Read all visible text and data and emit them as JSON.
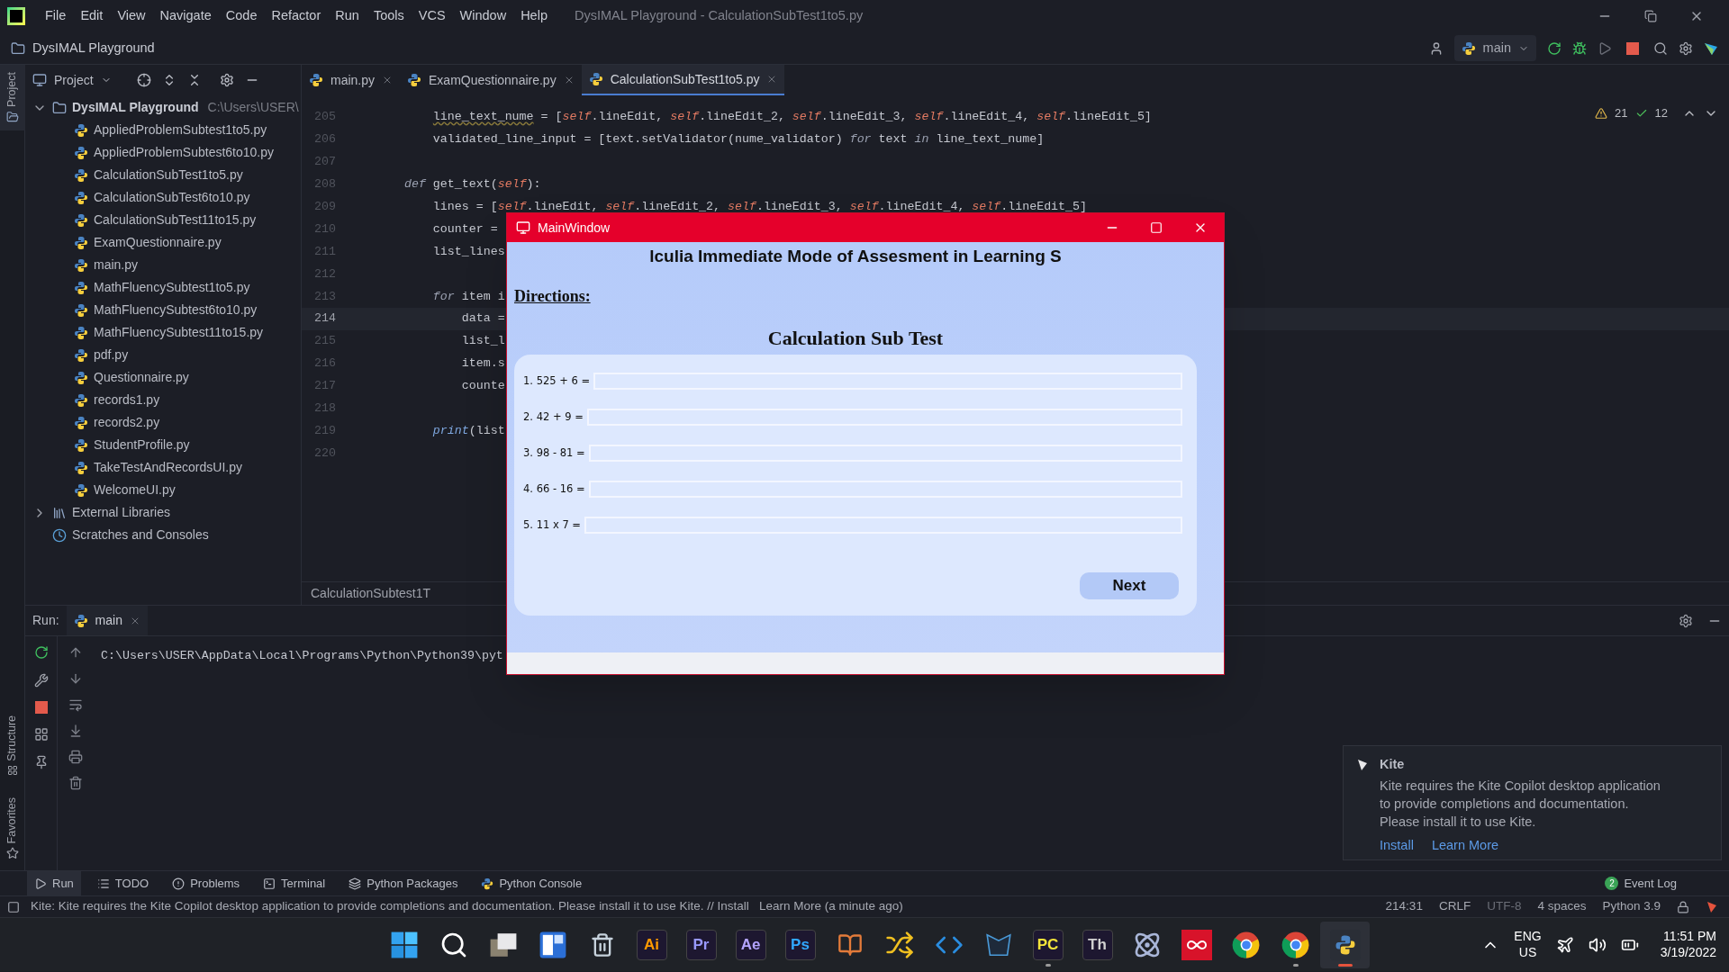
{
  "menu_bar": {
    "items": [
      "File",
      "Edit",
      "View",
      "Navigate",
      "Code",
      "Refactor",
      "Run",
      "Tools",
      "VCS",
      "Window",
      "Help"
    ],
    "title": "DysIMAL Playground - CalculationSubTest1to5.py"
  },
  "nav_bar": {
    "project": "DysIMAL Playground",
    "run_config": "main"
  },
  "project_panel": {
    "title": "Project",
    "tree": [
      {
        "label": "DysIMAL Playground",
        "path": "C:\\Users\\USER\\",
        "kind": "root",
        "expanded": true,
        "children": [
          {
            "label": "AppliedProblemSubtest1to5.py"
          },
          {
            "label": "AppliedProblemSubtest6to10.py"
          },
          {
            "label": "CalculationSubTest1to5.py"
          },
          {
            "label": "CalculationSubTest6to10.py"
          },
          {
            "label": "CalculationSubTest11to15.py"
          },
          {
            "label": "ExamQuestionnaire.py"
          },
          {
            "label": "main.py"
          },
          {
            "label": "MathFluencySubtest1to5.py"
          },
          {
            "label": "MathFluencySubtest6to10.py"
          },
          {
            "label": "MathFluencySubtest11to15.py"
          },
          {
            "label": "pdf.py"
          },
          {
            "label": "Questionnaire.py"
          },
          {
            "label": "records1.py"
          },
          {
            "label": "records2.py"
          },
          {
            "label": "StudentProfile.py"
          },
          {
            "label": "TakeTestAndRecordsUI.py"
          },
          {
            "label": "WelcomeUI.py"
          }
        ]
      },
      {
        "label": "External Libraries",
        "kind": "libraries",
        "expanded": false
      },
      {
        "label": "Scratches and Consoles",
        "kind": "scratches"
      }
    ]
  },
  "editor_tabs": [
    {
      "label": "main.py",
      "selected": false
    },
    {
      "label": "ExamQuestionnaire.py",
      "selected": false
    },
    {
      "label": "CalculationSubTest1to5.py",
      "selected": true
    }
  ],
  "inspections": {
    "warnings": "21",
    "passed": "12"
  },
  "code_lines": [
    {
      "number": "205",
      "current": false,
      "tokens": [
        {
          "kind": "typo",
          "text": "        line_text_nume"
        },
        {
          "kind": "plain",
          "text": " = ["
        },
        {
          "kind": "self",
          "text": "self"
        },
        {
          "kind": "plain",
          "text": ".lineEdit, "
        },
        {
          "kind": "self",
          "text": "self"
        },
        {
          "kind": "plain",
          "text": ".lineEdit_2, "
        },
        {
          "kind": "self",
          "text": "self"
        },
        {
          "kind": "plain",
          "text": ".lineEdit_3, "
        },
        {
          "kind": "self",
          "text": "self"
        },
        {
          "kind": "plain",
          "text": ".lineEdit_4, "
        },
        {
          "kind": "self",
          "text": "self"
        },
        {
          "kind": "plain",
          "text": ".lineEdit_5]"
        }
      ]
    },
    {
      "number": "206",
      "current": false,
      "tokens": [
        {
          "kind": "plain",
          "text": "        validated_line_input = [text.setValidator(nume_validator) "
        },
        {
          "kind": "keyword",
          "text": "for"
        },
        {
          "kind": "plain",
          "text": " text "
        },
        {
          "kind": "keyword",
          "text": "in"
        },
        {
          "kind": "plain",
          "text": " line_text_nume]"
        }
      ]
    },
    {
      "number": "207",
      "current": false
    },
    {
      "number": "208",
      "current": false,
      "tokens": [
        {
          "kind": "keyword",
          "text": "    def"
        },
        {
          "kind": "plain",
          "text": " get_text("
        },
        {
          "kind": "self",
          "text": "self"
        },
        {
          "kind": "plain",
          "text": "):"
        }
      ]
    },
    {
      "number": "209",
      "current": false,
      "tokens": [
        {
          "kind": "plain",
          "text": "        lines = ["
        },
        {
          "kind": "self",
          "text": "self"
        },
        {
          "kind": "plain",
          "text": ".lineEdit, "
        },
        {
          "kind": "self",
          "text": "self"
        },
        {
          "kind": "plain",
          "text": ".lineEdit_2, "
        },
        {
          "kind": "self",
          "text": "self"
        },
        {
          "kind": "plain",
          "text": ".lineEdit_3, "
        },
        {
          "kind": "self",
          "text": "self"
        },
        {
          "kind": "plain",
          "text": ".lineEdit_4, "
        },
        {
          "kind": "self",
          "text": "self"
        },
        {
          "kind": "plain",
          "text": ".lineEdit_5]"
        }
      ]
    },
    {
      "number": "210",
      "current": false,
      "tokens": [
        {
          "kind": "plain",
          "text": "        counter ="
        }
      ]
    },
    {
      "number": "211",
      "current": false,
      "tokens": [
        {
          "kind": "plain",
          "text": "        list_lines"
        }
      ]
    },
    {
      "number": "212",
      "current": false
    },
    {
      "number": "213",
      "current": false,
      "tokens": [
        {
          "kind": "keyword",
          "text": "        for"
        },
        {
          "kind": "plain",
          "text": " item i"
        }
      ]
    },
    {
      "number": "214",
      "current": true,
      "tokens": [
        {
          "kind": "plain",
          "text": "            data ="
        }
      ]
    },
    {
      "number": "215",
      "current": false,
      "tokens": [
        {
          "kind": "plain",
          "text": "            list_l"
        }
      ]
    },
    {
      "number": "216",
      "current": false,
      "tokens": [
        {
          "kind": "plain",
          "text": "            item.s"
        }
      ]
    },
    {
      "number": "217",
      "current": false,
      "tokens": [
        {
          "kind": "plain",
          "text": "            counte"
        }
      ]
    },
    {
      "number": "218",
      "current": false
    },
    {
      "number": "219",
      "current": false,
      "tokens": [
        {
          "kind": "builtin",
          "text": "        print"
        },
        {
          "kind": "plain",
          "text": "(list"
        }
      ]
    },
    {
      "number": "220",
      "current": false
    }
  ],
  "breadcrumb": "CalculationSubtest1T",
  "run_panel": {
    "label": "Run:",
    "tab": "main",
    "output": "C:\\Users\\USER\\AppData\\Local\\Programs\\Python\\Python39\\pyt"
  },
  "side_labels": {
    "top": "Project",
    "middle": "Structure",
    "bottom": "Favorites"
  },
  "tool_tabs": [
    {
      "label": "Run",
      "kind": "run",
      "selected": true
    },
    {
      "label": "TODO",
      "kind": "todo",
      "selected": false
    },
    {
      "label": "Problems",
      "kind": "problems",
      "selected": false
    },
    {
      "label": "Terminal",
      "kind": "terminal",
      "selected": false
    },
    {
      "label": "Python Packages",
      "kind": "packages",
      "selected": false
    },
    {
      "label": "Python Console",
      "kind": "console",
      "selected": false
    }
  ],
  "event_log": {
    "label": "Event Log",
    "count": "2"
  },
  "status_bar": {
    "message": "Kite: Kite requires the Kite Copilot desktop application to provide completions and documentation. Please install it to use Kite. // Install   Learn More (a minute ago)",
    "items": [
      "214:31",
      "CRLF",
      "UTF-8",
      "4 spaces",
      "Python 3.9"
    ]
  },
  "kite_popup": {
    "title": "Kite",
    "body_lines": [
      "Kite requires the Kite Copilot desktop application",
      "to provide completions and documentation.",
      "Please install it to use Kite."
    ],
    "actions": [
      "Install",
      "Learn More"
    ]
  },
  "app_window": {
    "title": "MainWindow",
    "heading": "lculia Immediate Mode of Assesment in Learning S",
    "directions": "Directions:",
    "section_title": "Calculation Sub Test",
    "questions": [
      {
        "label": "1. 525 + 6 ="
      },
      {
        "label": "2. 42 + 9 ="
      },
      {
        "label": "3. 98 - 81 ="
      },
      {
        "label": "4. 66 - 16 ="
      },
      {
        "label": "5. 11 x 7 ="
      }
    ],
    "next_button": "Next"
  },
  "taskbar": {
    "items": [
      {
        "kind": "start",
        "running": false,
        "selected": false
      },
      {
        "kind": "search",
        "running": false,
        "selected": false
      },
      {
        "kind": "taskview",
        "running": false,
        "selected": false
      },
      {
        "kind": "widgets",
        "running": false,
        "selected": false
      },
      {
        "kind": "bin",
        "running": false,
        "selected": false
      },
      {
        "kind": "letters",
        "text": "Ai",
        "color": "#ff9a00",
        "running": false,
        "selected": false
      },
      {
        "kind": "letters",
        "text": "Pr",
        "color": "#9999ff",
        "running": false,
        "selected": false
      },
      {
        "kind": "letters",
        "text": "Ae",
        "color": "#b3a4ff",
        "running": false,
        "selected": false
      },
      {
        "kind": "letters",
        "text": "Ps",
        "color": "#31a8ff",
        "running": false,
        "selected": false
      },
      {
        "kind": "books",
        "running": false,
        "selected": false
      },
      {
        "kind": "arrows",
        "running": false,
        "selected": false
      },
      {
        "kind": "code",
        "running": false,
        "selected": false
      },
      {
        "kind": "mask",
        "running": false,
        "selected": false
      },
      {
        "kind": "letters",
        "text": "PC",
        "color": "#f5e43a",
        "running": true,
        "selected": false
      },
      {
        "kind": "letters",
        "text": "Th",
        "color": "#d0d0d0",
        "running": false,
        "selected": false
      },
      {
        "kind": "atom",
        "running": false,
        "selected": false
      },
      {
        "kind": "infinity",
        "running": false,
        "selected": false
      },
      {
        "kind": "chrome",
        "running": false,
        "selected": false
      },
      {
        "kind": "chrome",
        "running": true,
        "selected": false
      },
      {
        "kind": "python",
        "running": true,
        "selected": true
      }
    ],
    "language": "ENG",
    "region": "US",
    "time": "11:51 PM",
    "date": "3/19/2022"
  }
}
